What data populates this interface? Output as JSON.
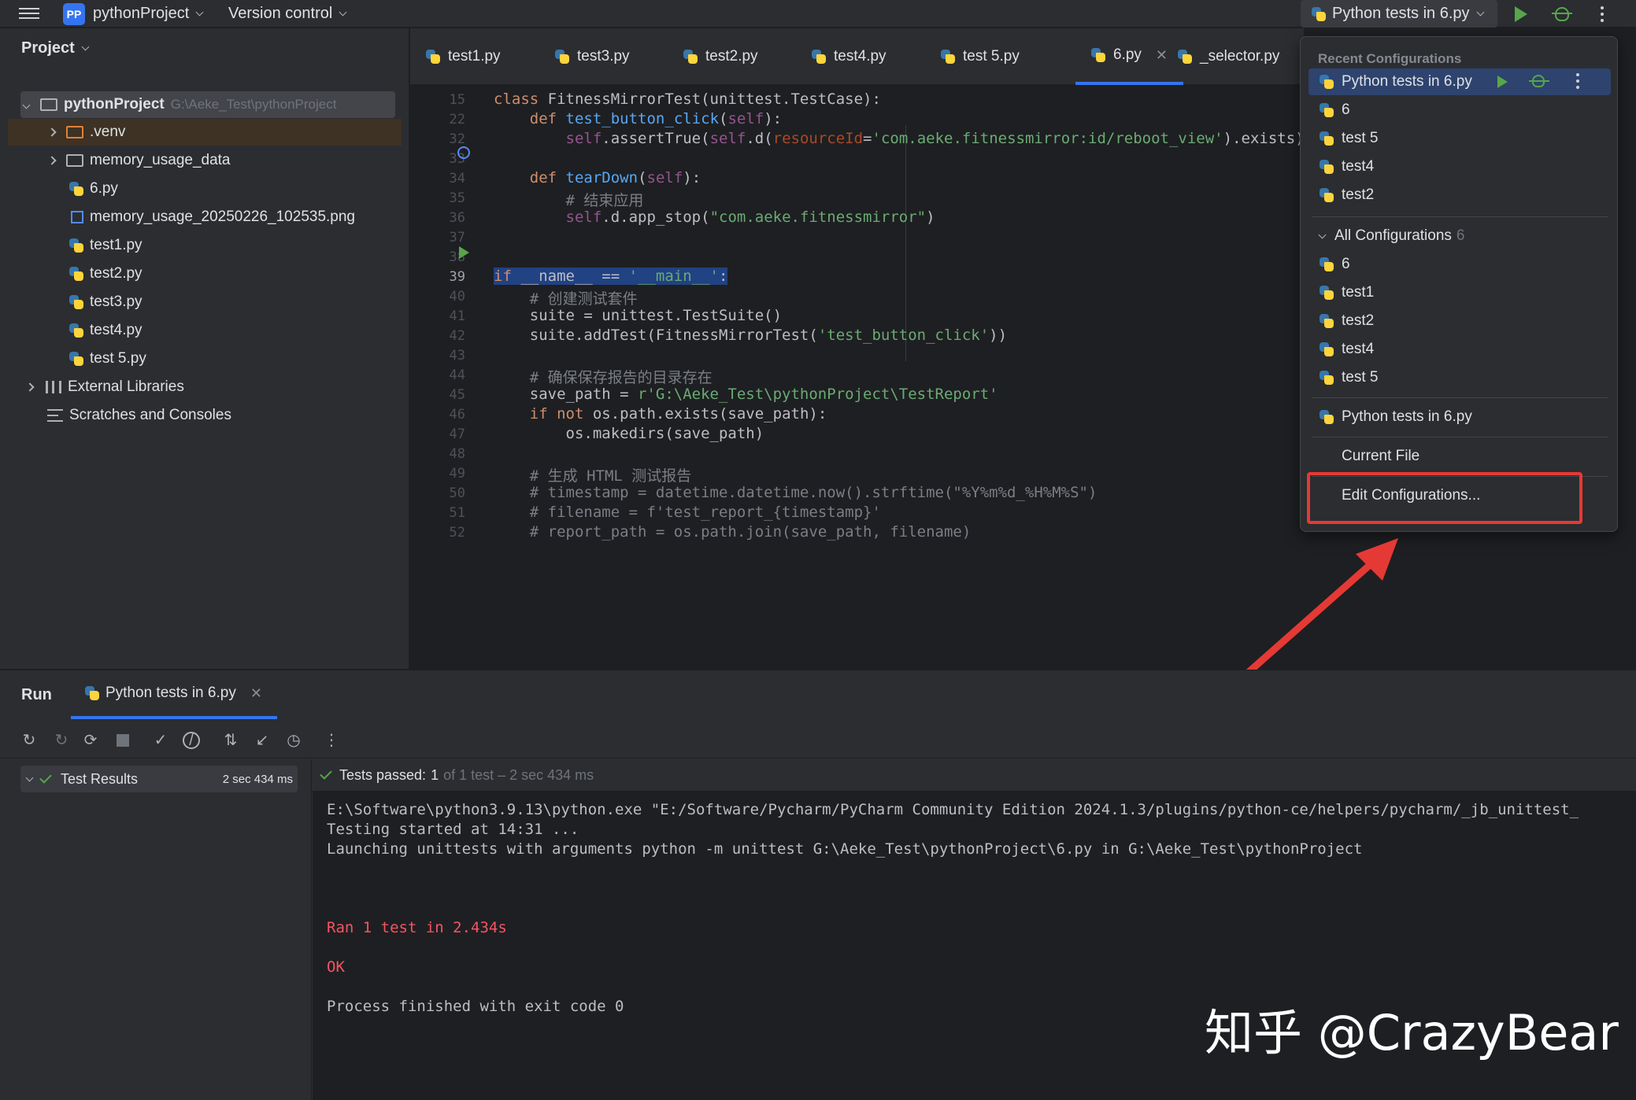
{
  "titlebar": {
    "project_badge": "PP",
    "project_name": "pythonProject",
    "vcs": "Version control",
    "run_config": "Python tests in 6.py"
  },
  "project": {
    "title": "Project",
    "root_name": "pythonProject",
    "root_path": "G:\\Aeke_Test\\pythonProject",
    "items": [
      {
        "label": ".venv"
      },
      {
        "label": "memory_usage_data"
      },
      {
        "label": "6.py"
      },
      {
        "label": "memory_usage_20250226_102535.png"
      },
      {
        "label": "test1.py"
      },
      {
        "label": "test2.py"
      },
      {
        "label": "test3.py"
      },
      {
        "label": "test4.py"
      },
      {
        "label": "test 5.py"
      },
      {
        "label": "External Libraries"
      },
      {
        "label": "Scratches and Consoles"
      }
    ]
  },
  "tabs": [
    "test1.py",
    "test3.py",
    "test2.py",
    "test4.py",
    "test 5.py",
    "6.py",
    "_selector.py"
  ],
  "editor": {
    "line_numbers": [
      "15",
      "22",
      "32",
      "33",
      "34",
      "35",
      "36",
      "37",
      "38",
      "39",
      "40",
      "41",
      "42",
      "43",
      "44",
      "45",
      "46",
      "47",
      "48",
      "49",
      "50",
      "51",
      "52"
    ]
  },
  "popup": {
    "recent_header": "Recent Configurations",
    "recent": [
      "Python tests in 6.py",
      "6",
      "test 5",
      "test4",
      "test2"
    ],
    "all_header": "All Configurations",
    "all_count": "6",
    "all": [
      "6",
      "test1",
      "test2",
      "test4",
      "test 5"
    ],
    "python_tests": "Python tests in 6.py",
    "current_file": "Current File",
    "edit": "Edit Configurations..."
  },
  "run": {
    "title": "Run",
    "tab_label": "Python tests in 6.py",
    "results_label": "Test Results",
    "results_time": "2 sec 434 ms",
    "status_prefix": "Tests passed:",
    "status_count": "1",
    "status_rest": "of 1 test – 2 sec 434 ms",
    "console": [
      "E:\\Software\\python3.9.13\\python.exe \"E:/Software/Pycharm/PyCharm Community Edition 2024.1.3/plugins/python-ce/helpers/pycharm/_jb_unittest_",
      "Testing started at 14:31 ...",
      "Launching unittests with arguments python -m unittest G:\\Aeke_Test\\pythonProject\\6.py in G:\\Aeke_Test\\pythonProject",
      "Ran 1 test in 2.434s",
      "OK",
      "Process finished with exit code 0"
    ]
  },
  "watermark": "知乎 @CrazyBear",
  "colors": {
    "accent": "#3574f0",
    "run_green": "#57a64a",
    "highlight_red": "#e53935"
  }
}
